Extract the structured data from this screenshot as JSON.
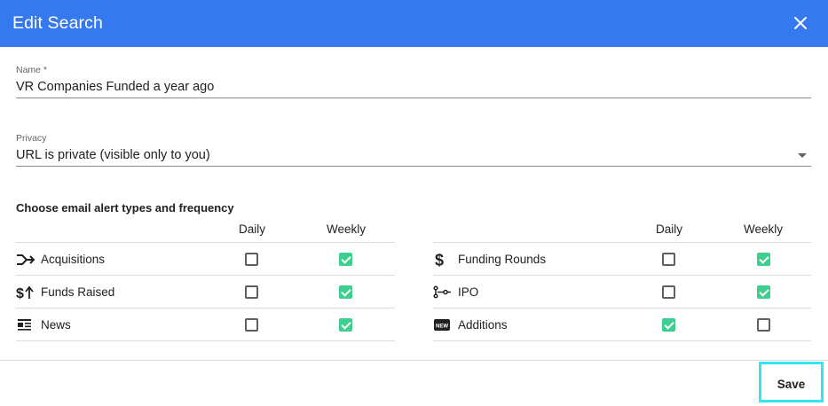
{
  "dialog": {
    "title": "Edit Search",
    "close_icon": "close-icon"
  },
  "name_field": {
    "label": "Name *",
    "value": "VR Companies Funded a year ago"
  },
  "privacy_field": {
    "label": "Privacy",
    "value": "URL is private (visible only to you)"
  },
  "alerts": {
    "title": "Choose email alert types and frequency",
    "col_daily": "Daily",
    "col_weekly": "Weekly",
    "left": [
      {
        "label": "Acquisitions",
        "icon": "merge-arrow-icon",
        "daily": false,
        "weekly": true
      },
      {
        "label": "Funds Raised",
        "icon": "dollar-up-icon",
        "daily": false,
        "weekly": true
      },
      {
        "label": "News",
        "icon": "news-icon",
        "daily": false,
        "weekly": true
      }
    ],
    "right": [
      {
        "label": "Funding Rounds",
        "icon": "dollar-icon",
        "daily": false,
        "weekly": true
      },
      {
        "label": "IPO",
        "icon": "ipo-icon",
        "daily": false,
        "weekly": true
      },
      {
        "label": "Additions",
        "icon": "new-badge-icon",
        "daily": true,
        "weekly": false
      }
    ]
  },
  "footer": {
    "save_label": "Save"
  },
  "colors": {
    "header": "#3679ef",
    "checkbox_on": "#3ecf8e",
    "save_highlight": "#33e6f2"
  }
}
